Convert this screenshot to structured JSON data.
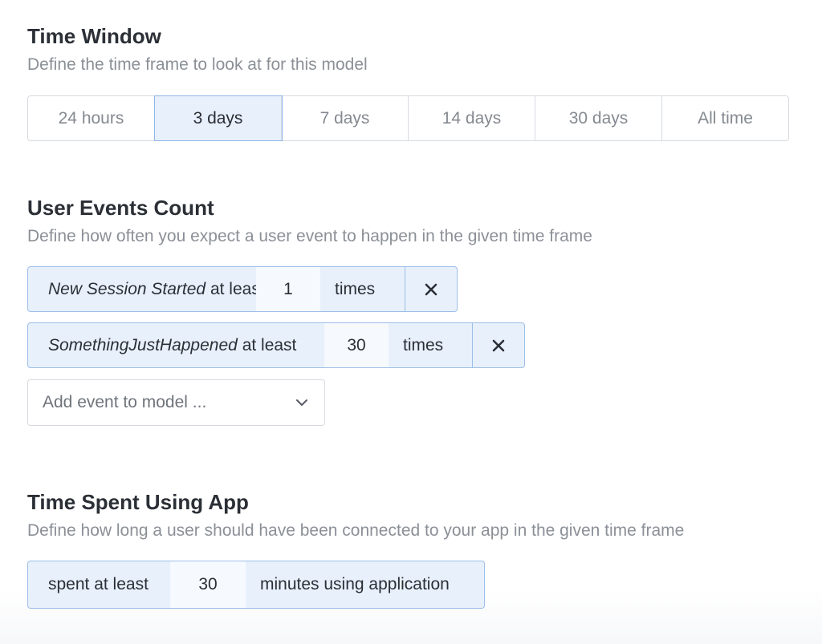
{
  "time_window": {
    "title": "Time Window",
    "description": "Define the time frame to look at for this model",
    "options": [
      "24 hours",
      "3 days",
      "7 days",
      "14 days",
      "30 days",
      "All time"
    ],
    "selected": "3 days"
  },
  "user_events": {
    "title": "User Events Count",
    "description": "Define how often you expect a user event to happen in the given time frame",
    "rows": [
      {
        "event": "New Session Started",
        "qualifier": "at least",
        "count": "1",
        "unit": "times"
      },
      {
        "event": "SomethingJustHappened",
        "qualifier": "at least",
        "count": "30",
        "unit": "times"
      }
    ],
    "add_placeholder": "Add event to model ..."
  },
  "time_spent": {
    "title": "Time Spent Using App",
    "description": "Define how long a user should have been connected to your app in the given time frame",
    "prefix": "spent at least",
    "value": "30",
    "suffix": "minutes using application"
  },
  "colors": {
    "accent_bg": "#e8f0fb",
    "accent_border": "#9dbfe9",
    "text": "#2b2f36",
    "muted": "#8b9097"
  },
  "icons": {
    "remove": "close-icon",
    "dropdown": "chevron-down-icon"
  }
}
